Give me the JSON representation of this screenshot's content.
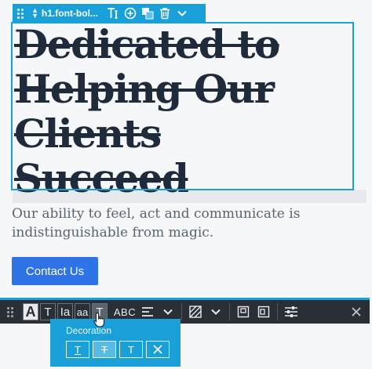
{
  "element_toolbar": {
    "selector": "h1.font-bol...",
    "icons": [
      "drag-handle-icon",
      "move-up-down-icon",
      "text-cursor-icon",
      "add-circle-icon",
      "layers-icon",
      "trash-icon",
      "chevron-down-icon"
    ]
  },
  "heading": {
    "lines": [
      "Dedicated to",
      "Helping Our",
      "Clients",
      "Succeed"
    ]
  },
  "paragraph": {
    "lines": [
      "Our ability to feel, act and communicate is",
      "indistinguishable from magic."
    ]
  },
  "cta": {
    "label": "Contact Us"
  },
  "text_toolbar": {
    "bold": "A",
    "regular": "T",
    "italic": "Ia",
    "case": "aa",
    "decoration": "T",
    "transform": "ABC"
  },
  "decoration_popup": {
    "title": "Decoration",
    "options": [
      "T",
      "T",
      "T"
    ]
  },
  "colors": {
    "accent": "#1aa0d8",
    "toolbar_bg": "#2a2f36",
    "button": "#2e74e6",
    "heading": "#1f2a3a"
  }
}
